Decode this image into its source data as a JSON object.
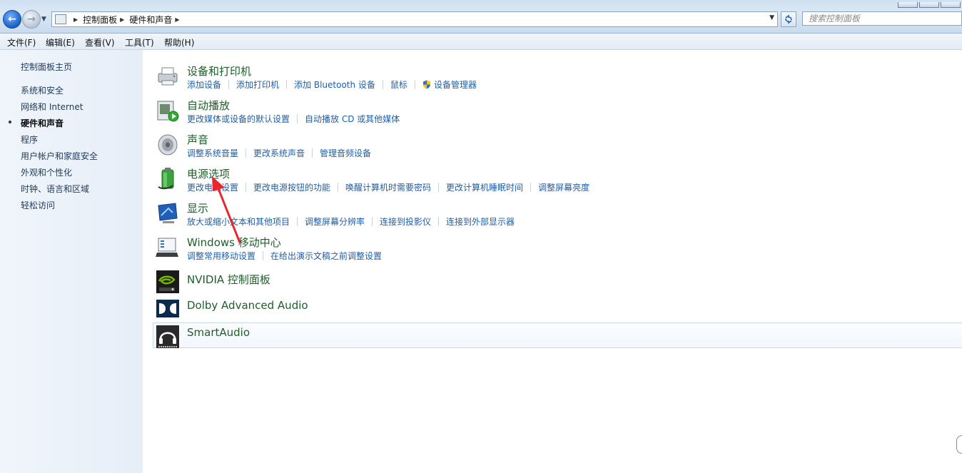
{
  "address_bar": {
    "breadcrumbs": [
      "控制面板",
      "硬件和声音"
    ],
    "search_placeholder": "搜索控制面板"
  },
  "menu": [
    "文件(F)",
    "编辑(E)",
    "查看(V)",
    "工具(T)",
    "帮助(H)"
  ],
  "sidebar": {
    "home": "控制面板主页",
    "items": [
      {
        "label": "系统和安全"
      },
      {
        "label": "网络和 Internet"
      },
      {
        "label": "硬件和声音",
        "current": true
      },
      {
        "label": "程序"
      },
      {
        "label": "用户帐户和家庭安全"
      },
      {
        "label": "外观和个性化"
      },
      {
        "label": "时钟、语言和区域"
      },
      {
        "label": "轻松访问"
      }
    ]
  },
  "categories": [
    {
      "title": "设备和打印机",
      "icon": "printer-icon",
      "links": [
        "添加设备",
        "添加打印机",
        "添加 Bluetooth 设备",
        "鼠标",
        "设备管理器"
      ]
    },
    {
      "title": "自动播放",
      "icon": "autoplay-icon",
      "links": [
        "更改媒体或设备的默认设置",
        "自动播放 CD 或其他媒体"
      ]
    },
    {
      "title": "声音",
      "icon": "speaker-icon",
      "links": [
        "调整系统音量",
        "更改系统声音",
        "管理音频设备"
      ]
    },
    {
      "title": "电源选项",
      "icon": "battery-icon",
      "links": [
        "更改电源设置",
        "更改电源按钮的功能",
        "唤醒计算机时需要密码",
        "更改计算机睡眠时间",
        "调整屏幕亮度"
      ]
    },
    {
      "title": "显示",
      "icon": "monitor-icon",
      "links": [
        "放大或缩小文本和其他项目",
        "调整屏幕分辨率",
        "连接到投影仪",
        "连接到外部显示器"
      ]
    },
    {
      "title": "Windows 移动中心",
      "icon": "mobility-center-icon",
      "links": [
        "调整常用移动设置",
        "在给出演示文稿之前调整设置"
      ]
    },
    {
      "title": "NVIDIA 控制面板",
      "icon": "nvidia-icon",
      "links": []
    },
    {
      "title": "Dolby Advanced Audio",
      "icon": "dolby-icon",
      "links": []
    },
    {
      "title": "SmartAudio",
      "icon": "headphones-icon",
      "links": []
    }
  ],
  "colors": {
    "link": "#1d5fa8",
    "category_title": "#1e5e2a",
    "annotation_arrow": "#e8262b"
  }
}
